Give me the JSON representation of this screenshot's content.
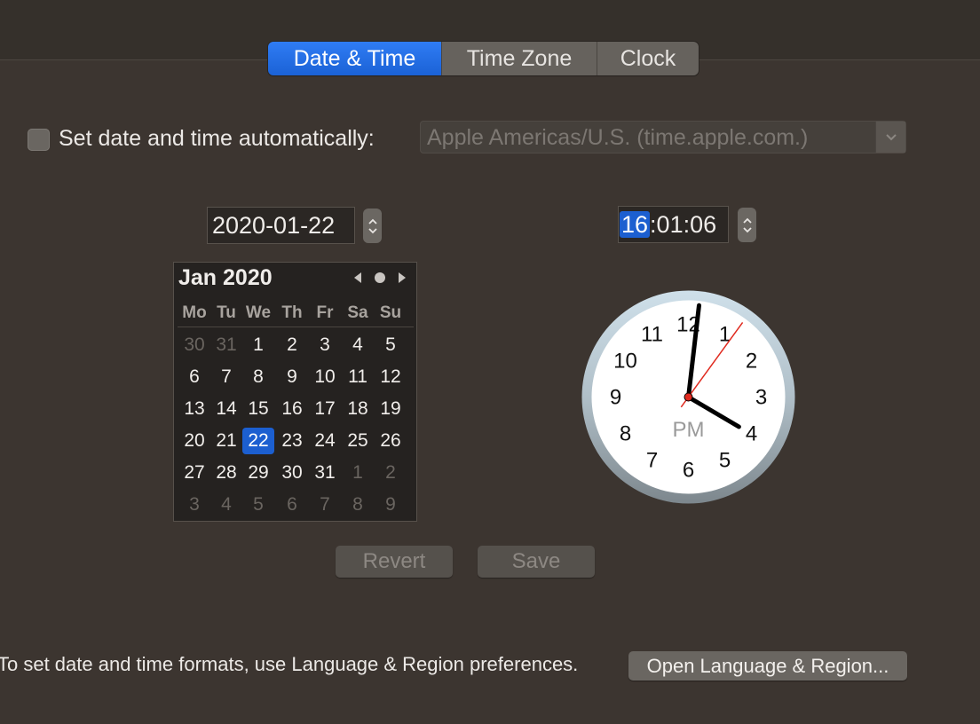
{
  "tabs": [
    {
      "label": "Date & Time",
      "active": true
    },
    {
      "label": "Time Zone",
      "active": false
    },
    {
      "label": "Clock",
      "active": false
    }
  ],
  "auto": {
    "label": "Set date and time automatically:",
    "checked": false,
    "server": "Apple Americas/U.S. (time.apple.com.)"
  },
  "date_field": {
    "value": "2020-01-22"
  },
  "time_field": {
    "hours": "16",
    "rest": ":01:06"
  },
  "calendar": {
    "month_label": "Jan 2020",
    "weekdays": [
      "Mo",
      "Tu",
      "We",
      "Th",
      "Fr",
      "Sa",
      "Su"
    ],
    "weeks": [
      [
        "30",
        "31",
        "1",
        "2",
        "3",
        "4",
        "5"
      ],
      [
        "6",
        "7",
        "8",
        "9",
        "10",
        "11",
        "12"
      ],
      [
        "13",
        "14",
        "15",
        "16",
        "17",
        "18",
        "19"
      ],
      [
        "20",
        "21",
        "22",
        "23",
        "24",
        "25",
        "26"
      ],
      [
        "27",
        "28",
        "29",
        "30",
        "31",
        "1",
        "2"
      ],
      [
        "3",
        "4",
        "5",
        "6",
        "7",
        "8",
        "9"
      ]
    ],
    "selected_day": "22"
  },
  "clock": {
    "numerals": [
      "12",
      "1",
      "2",
      "3",
      "4",
      "5",
      "6",
      "7",
      "8",
      "9",
      "10",
      "11"
    ],
    "period": "PM",
    "hour": 16,
    "minute": 1,
    "second": 6
  },
  "buttons": {
    "revert": "Revert",
    "save": "Save"
  },
  "footer": {
    "text": "To set date and time formats, use Language & Region preferences.",
    "open_button": "Open Language & Region..."
  },
  "colors": {
    "accent": "#1c5fd0",
    "background": "#3c3530",
    "second_hand": "#e02a1f"
  }
}
